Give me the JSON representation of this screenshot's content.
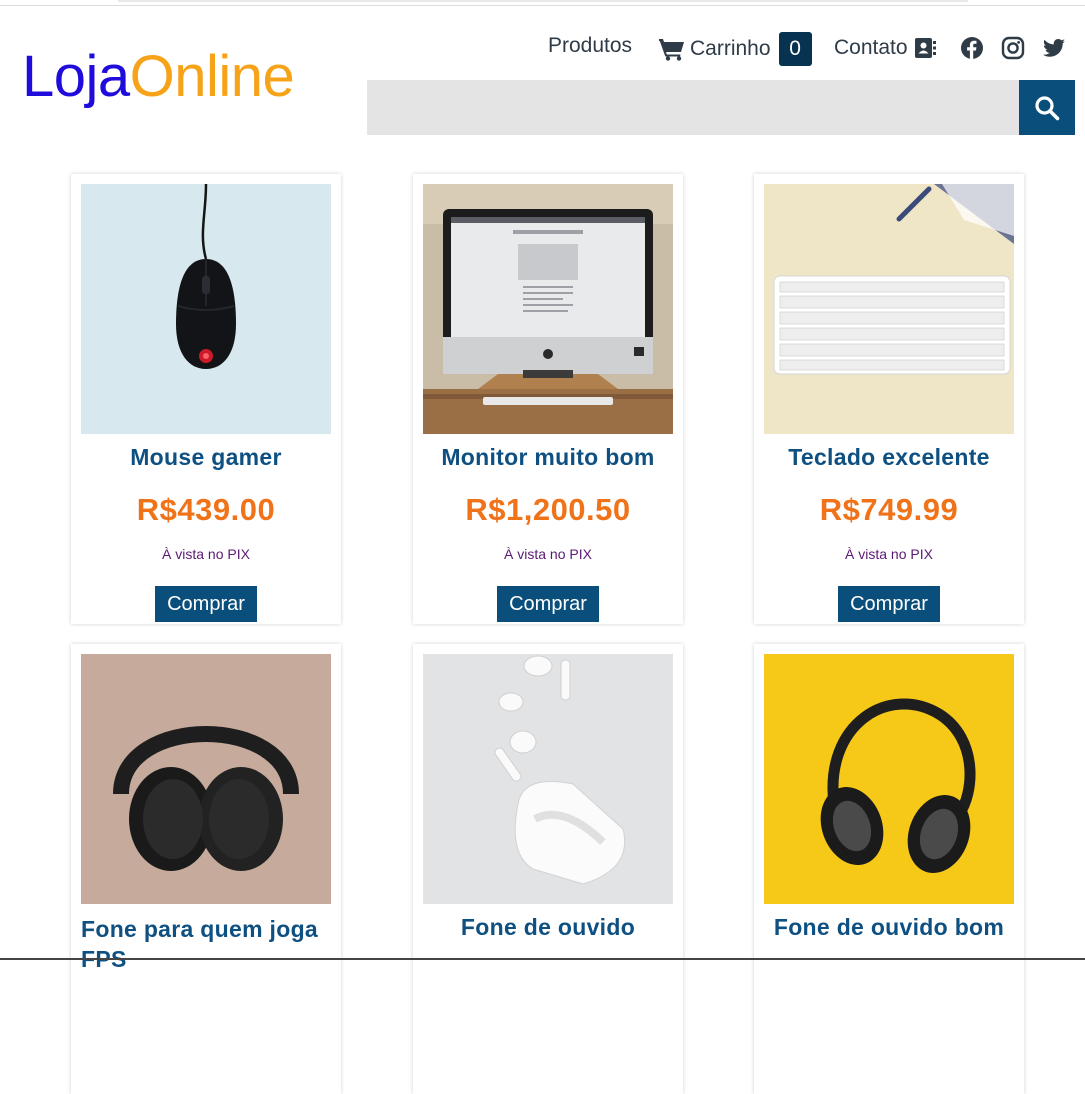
{
  "brand": {
    "part1": "Loja",
    "part2": "Online",
    "color1": "#1f0bdc",
    "color2": "#f7a31a"
  },
  "nav": {
    "products_label": "Produtos",
    "cart_label": "Carrinho",
    "cart_count": "0",
    "contact_label": "Contato",
    "icons": [
      "cart-icon",
      "contact-card-icon",
      "facebook-icon",
      "instagram-icon",
      "twitter-icon"
    ]
  },
  "search": {
    "placeholder": "",
    "value": "",
    "button_icon": "search-icon"
  },
  "products": [
    {
      "name": "Mouse gamer",
      "price": "R$439.00",
      "payment_note": "À vista no PIX",
      "buy_label": "Comprar",
      "image": "black-gaming-mouse-on-light-blue"
    },
    {
      "name": "Monitor muito bom",
      "price": "R$1,200.50",
      "payment_note": "À vista no PIX",
      "buy_label": "Comprar",
      "image": "desktop-monitor-on-wooden-desk"
    },
    {
      "name": "Teclado excelente",
      "price": "R$749.99",
      "payment_note": "À vista no PIX",
      "buy_label": "Comprar",
      "image": "white-keyboard-on-beige"
    },
    {
      "name": "Fone para quem joga FPS",
      "price": "",
      "payment_note": "",
      "buy_label": "",
      "image": "black-over-ear-headphones-on-pink"
    },
    {
      "name": "Fone de ouvido",
      "price": "",
      "payment_note": "",
      "buy_label": "",
      "image": "white-earbuds-and-case"
    },
    {
      "name": "Fone de ouvido bom",
      "price": "",
      "payment_note": "",
      "buy_label": "",
      "image": "black-headphones-on-yellow"
    }
  ],
  "colors": {
    "accent": "#0a4f7c",
    "product_name": "#0f5082",
    "price": "#f07319",
    "pix_note": "#5b1a73",
    "cart_badge": "#073350"
  }
}
